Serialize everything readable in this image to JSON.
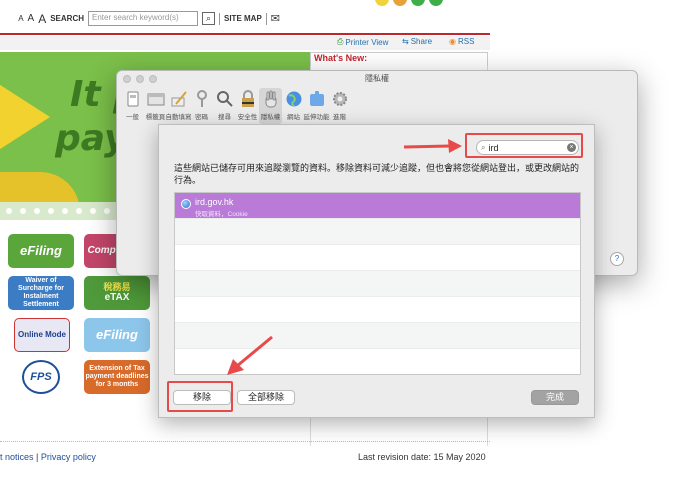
{
  "site": {
    "font_sizes": [
      "A",
      "A",
      "A"
    ],
    "search_label": "SEARCH",
    "search_placeholder": "Enter search keyword(s)",
    "sitemap": "SITE MAP",
    "printer_view": "Printer View",
    "share": "Share",
    "rss": "RSS",
    "whats_new": "What's New:",
    "banner_line1": "It p",
    "banner_line2": "pay ta",
    "tiles": {
      "efiling": "eFiling",
      "compl": "Compl",
      "waiver": "Waiver of Surcharge for Instalment Settlement",
      "etax_cn": "稅務易",
      "etax": "eTAX",
      "online_mode": "Online Mode",
      "efiling2": "eFiling",
      "fps": "FPS",
      "extension": "Extension of Tax payment deadlines for 3 months"
    },
    "footer": {
      "notices": "t notices",
      "separator": "|",
      "privacy": "Privacy policy",
      "revision": "Last revision date: 15 May 2020"
    }
  },
  "prefs": {
    "title": "隱私權",
    "tabs": [
      {
        "label": "一般",
        "icon": "general-icon"
      },
      {
        "label": "標籤頁",
        "icon": "tabs-icon"
      },
      {
        "label": "自動填寫",
        "icon": "autofill-icon"
      },
      {
        "label": "密碼",
        "icon": "key-icon"
      },
      {
        "label": "搜尋",
        "icon": "search-icon"
      },
      {
        "label": "安全性",
        "icon": "lock-icon"
      },
      {
        "label": "隱私權",
        "icon": "hand-icon",
        "active": true
      },
      {
        "label": "網站",
        "icon": "globe-icon"
      },
      {
        "label": "延伸功能",
        "icon": "extensions-icon"
      },
      {
        "label": "進階",
        "icon": "gear-icon"
      }
    ],
    "help": "?"
  },
  "sheet": {
    "search_value": "ird",
    "description": "這些網站已儲存可用來追蹤瀏覽的資料。移除資料可減少追蹤，但也會將您從網站登出，或更改網站的行為。",
    "rows": [
      {
        "site": "ird.gov.hk",
        "detail": "快取資料，Cookie",
        "selected": true
      }
    ],
    "remove": "移除",
    "remove_all": "全部移除",
    "done": "完成"
  },
  "colors": {
    "accent_red": "#e84a4a",
    "selection": "#b97ad8",
    "site_red": "#c0262c",
    "site_green": "#7bc04a"
  }
}
